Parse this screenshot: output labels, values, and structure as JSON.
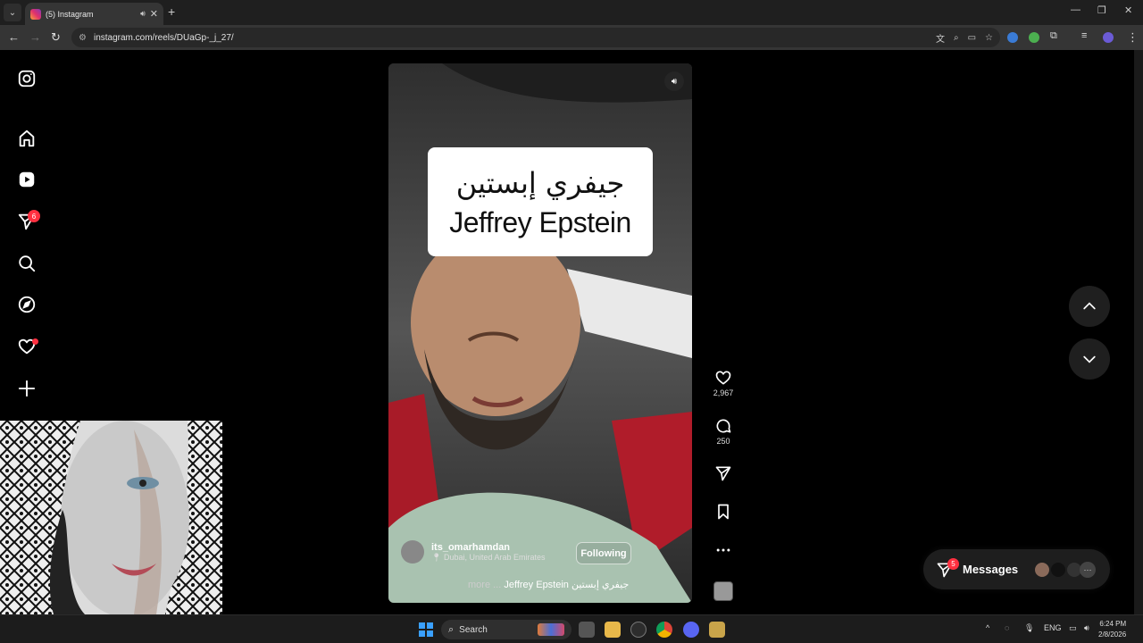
{
  "browser": {
    "tab_title": "(5) Instagram",
    "tab_audio_icon": "speaker-icon",
    "tab_close": "✕",
    "new_tab": "+",
    "url": "instagram.com/reels/DUaGp-_j_27/",
    "window_controls": [
      "—",
      "❐",
      "✕"
    ]
  },
  "sidebar": {
    "items": [
      {
        "name": "instagram-logo",
        "icon": "instagram-icon"
      },
      {
        "name": "home",
        "icon": "home-icon"
      },
      {
        "name": "reels",
        "icon": "reels-icon"
      },
      {
        "name": "messages",
        "icon": "paper-plane-icon",
        "badge": "6"
      },
      {
        "name": "search",
        "icon": "search-icon"
      },
      {
        "name": "explore",
        "icon": "compass-icon"
      },
      {
        "name": "notifications",
        "icon": "heart-icon",
        "dot": true
      },
      {
        "name": "create",
        "icon": "plus-icon"
      }
    ]
  },
  "reel": {
    "caption_arabic": "جيفري إبستين",
    "caption_english": "Jeffrey Epstein",
    "author": "its_omarhamdan",
    "location": "Dubai, United Arab Emirates",
    "follow_label": "Following",
    "caption_more": "more ...",
    "caption_text": "Jeffrey Epstein جيفري إبستين",
    "likes": "2,967",
    "comments": "250"
  },
  "messages": {
    "label": "Messages",
    "badge": "5"
  },
  "taskbar": {
    "search_label": "Search",
    "language": "ENG",
    "time": "6:24 PM",
    "date": "2/8/2026"
  },
  "colors": {
    "badge": "#ff3040",
    "background": "#000000",
    "chrome": "#353535"
  }
}
